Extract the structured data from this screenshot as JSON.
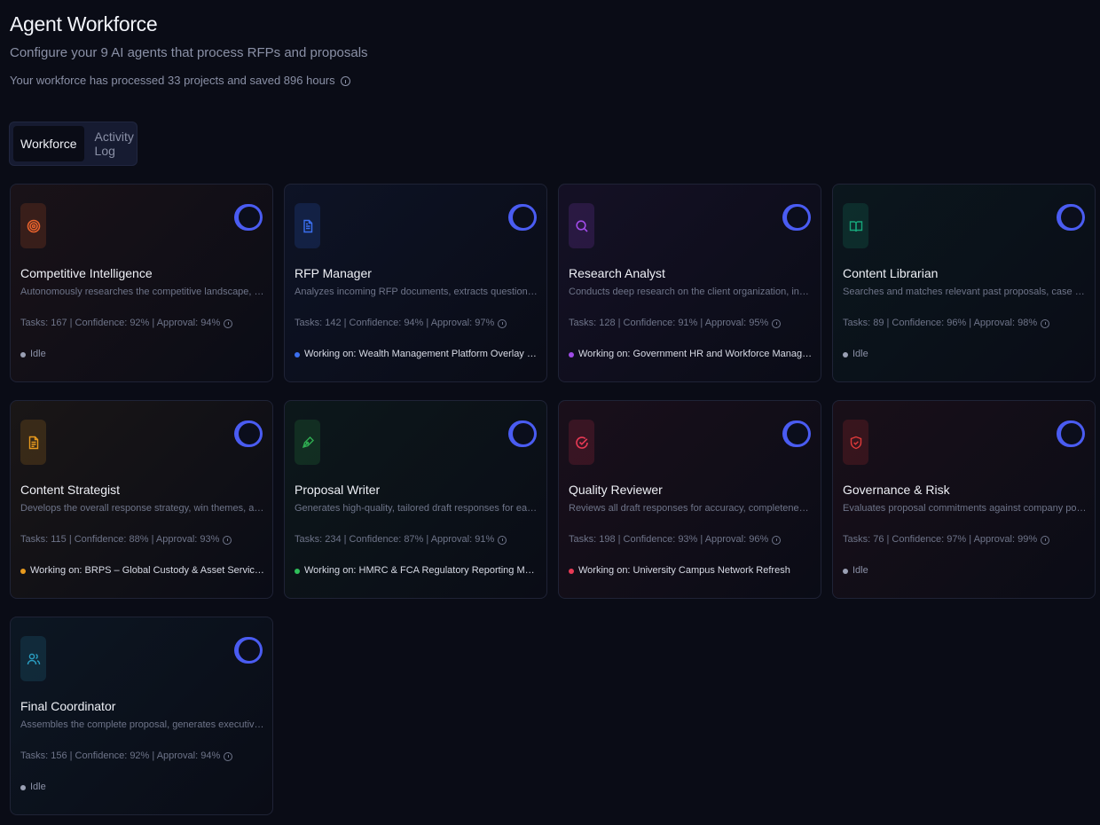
{
  "header": {
    "title": "Agent Workforce",
    "subtitle": "Configure your 9 AI agents that process RFPs and proposals",
    "stats": "Your workforce has processed 33 projects and saved 896 hours"
  },
  "tabs": [
    {
      "label": "Workforce",
      "active": true
    },
    {
      "label": "Activity Log",
      "active": false
    }
  ],
  "agents": [
    {
      "name": "Competitive Intelligence",
      "description": "Autonomously researches the competitive landscape, identifies lik...",
      "stats": "Tasks: 167 | Confidence: 92% | Approval: 94%",
      "status": "Idle",
      "active": true,
      "icon": "target-icon",
      "accent": "#e8622c",
      "status_color": "#9aa0b4"
    },
    {
      "name": "RFP Manager",
      "description": "Analyzes incoming RFP documents, extracts questions and require...",
      "stats": "Tasks: 142 | Confidence: 94% | Approval: 97%",
      "status": "Working on: Wealth Management Platform Overlay — BT Pensio...",
      "active": true,
      "icon": "document-icon",
      "accent": "#3b6ff0",
      "status_color": "#3b6ff0"
    },
    {
      "name": "Research Analyst",
      "description": "Conducts deep research on the client organization, industry trends...",
      "stats": "Tasks: 128 | Confidence: 91% | Approval: 95%",
      "status": "Working on: Government HR and Workforce Management System",
      "active": true,
      "icon": "search-icon",
      "accent": "#a04be8",
      "status_color": "#a04be8"
    },
    {
      "name": "Content Librarian",
      "description": "Searches and matches relevant past proposals, case studies, and ...",
      "stats": "Tasks: 89 | Confidence: 96% | Approval: 98%",
      "status": "Idle",
      "active": true,
      "icon": "book-icon",
      "accent": "#17a67a",
      "status_color": "#9aa0b4"
    },
    {
      "name": "Content Strategist",
      "description": "Develops the overall response strategy, win themes, and content o...",
      "stats": "Tasks: 115 | Confidence: 88% | Approval: 93%",
      "status": "Working on: BRPS – Global Custody & Asset Servicing RFP",
      "active": true,
      "icon": "file-text-icon",
      "accent": "#e89a1e",
      "status_color": "#e89a1e"
    },
    {
      "name": "Proposal Writer",
      "description": "Generates high-quality, tailored draft responses for each RFP ques...",
      "stats": "Tasks: 234 | Confidence: 87% | Approval: 91%",
      "status": "Working on: HMRC & FCA Regulatory Reporting Modernisation",
      "active": true,
      "icon": "pen-icon",
      "accent": "#2fae52",
      "status_color": "#2fbf5a"
    },
    {
      "name": "Quality Reviewer",
      "description": "Reviews all draft responses for accuracy, completeness, complian...",
      "stats": "Tasks: 198 | Confidence: 93% | Approval: 96%",
      "status": "Working on: University Campus Network Refresh",
      "active": true,
      "icon": "check-circle-icon",
      "accent": "#e83a55",
      "status_color": "#e83a55"
    },
    {
      "name": "Governance & Risk",
      "description": "Evaluates proposal commitments against company policies, risk th...",
      "stats": "Tasks: 76 | Confidence: 97% | Approval: 99%",
      "status": "Idle",
      "active": true,
      "icon": "shield-check-icon",
      "accent": "#e03a3a",
      "status_color": "#9aa0b4"
    },
    {
      "name": "Final Coordinator",
      "description": "Assembles the complete proposal, generates executive summary, ...",
      "stats": "Tasks: 156 | Confidence: 92% | Approval: 94%",
      "status": "Idle",
      "active": true,
      "icon": "users-icon",
      "accent": "#2a9ec2",
      "status_color": "#9aa0b4"
    }
  ]
}
